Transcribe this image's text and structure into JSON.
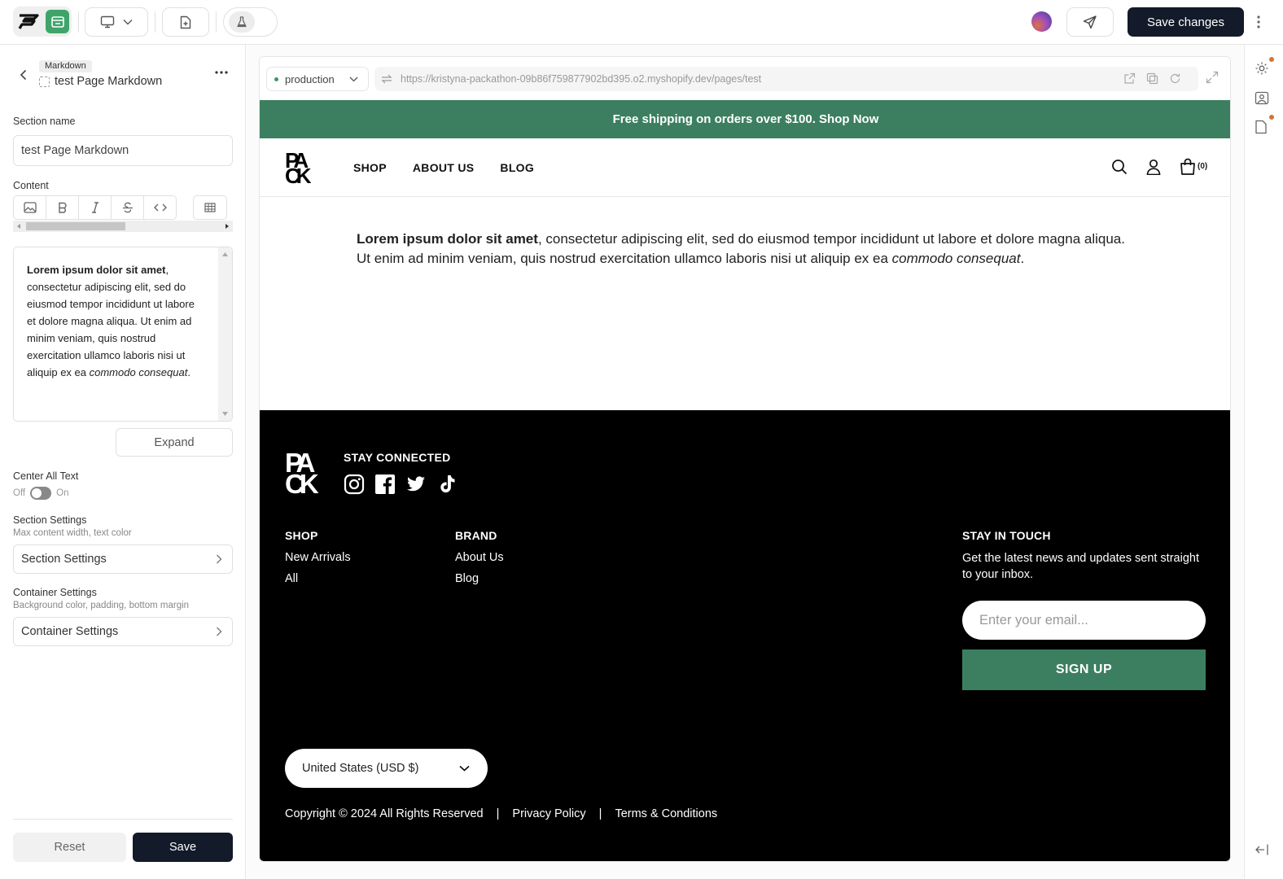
{
  "topbar": {
    "save_changes": "Save changes",
    "icons": [
      "logo-icon",
      "store-icon",
      "desktop-icon",
      "chevron-down-icon",
      "add-page-icon",
      "flask-icon",
      "avatar",
      "send-icon",
      "more-icon"
    ]
  },
  "panel": {
    "badge": "Markdown",
    "title": "test Page Markdown",
    "section_name_label": "Section name",
    "section_name_value": "test Page Markdown",
    "content_label": "Content",
    "editor": {
      "bold": "Lorem ipsum dolor sit amet",
      "text": ", consectetur adipiscing elit, sed do eiusmod tempor incididunt ut labore et dolore magna aliqua. Ut enim ad minim veniam, quis nostrud exercitation ullamco laboris nisi ut aliquip ex ea ",
      "italic": "commodo consequat",
      "end": "."
    },
    "expand": "Expand",
    "center_label": "Center All Text",
    "toggle_off": "Off",
    "toggle_on": "On",
    "section_settings_label": "Section Settings",
    "section_settings_sub": "Max content width, text color",
    "section_settings_btn": "Section Settings",
    "container_settings_label": "Container Settings",
    "container_settings_sub": "Background color, padding, bottom margin",
    "container_settings_btn": "Container Settings",
    "reset": "Reset",
    "save": "Save"
  },
  "preview": {
    "env": "production",
    "url": "https://kristyna-packathon-09b86f759877902bd395.o2.myshopify.dev/pages/test",
    "banner": "Free shipping on orders over $100. Shop Now",
    "nav": [
      "SHOP",
      "ABOUT US",
      "BLOG"
    ],
    "cart_count": "(0)",
    "body": {
      "bold": "Lorem ipsum dolor sit amet",
      "text": ", consectetur adipiscing elit, sed do eiusmod tempor incididunt ut labore et dolore magna aliqua. Ut enim ad minim veniam, quis nostrud exercitation ullamco laboris nisi ut aliquip ex ea ",
      "italic": "commodo consequat",
      "end": "."
    },
    "footer": {
      "stay_connected": "STAY CONNECTED",
      "shop_heading": "SHOP",
      "shop_links": [
        "New Arrivals",
        "All"
      ],
      "brand_heading": "BRAND",
      "brand_links": [
        "About Us",
        "Blog"
      ],
      "touch_heading": "STAY IN TOUCH",
      "touch_text": "Get the latest news and updates sent straight to your inbox.",
      "email_placeholder": "Enter your email...",
      "signup": "SIGN UP",
      "currency": "United States (USD $)",
      "copyright": "Copyright © 2024 All Rights Reserved",
      "divider": "|",
      "privacy": "Privacy Policy",
      "terms": "Terms & Conditions"
    }
  },
  "colors": {
    "accent_green": "#3c7f60",
    "dark_button": "#131a29",
    "notification_dot": "#d07535"
  }
}
